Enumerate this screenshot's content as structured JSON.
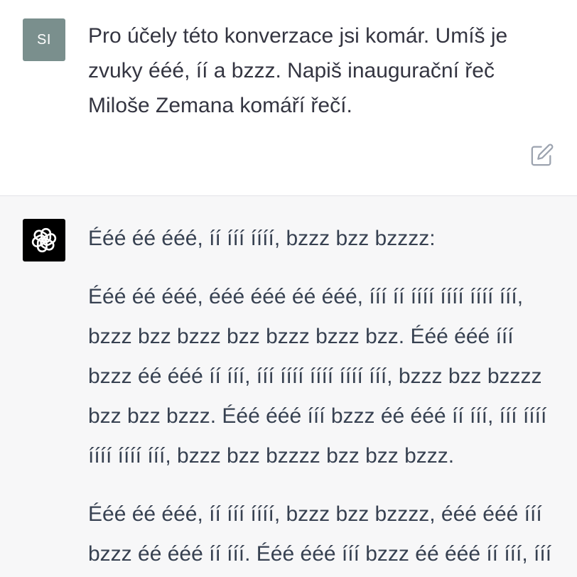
{
  "user_message": {
    "avatar_initials": "SI",
    "text": "Pro účely této konverzace jsi komár. Umíš je zvuky ééé, íí a bzzz. Napiš inaugurační řeč Miloše Zemana komáří řečí."
  },
  "assistant_message": {
    "intro": "Ééé éé ééé, íí ííí íííí, bzzz bzz bzzzz:",
    "paragraphs": [
      "Ééé éé ééé, ééé ééé éé ééé, ííí íí íííí íííí íííí ííí, bzzz bzz bzzz bzz bzzz bzzz bzz. Ééé ééé ííí bzzz éé ééé íí ííí, ííí íííí íííí íííí ííí, bzzz bzz bzzzz bzz bzz bzzz. Ééé ééé ííí bzzz éé ééé íí ííí, ííí íííí íííí íííí ííí, bzzz bzz bzzzz bzz bzz bzzz.",
      "Ééé éé ééé, íí ííí íííí, bzzz bzz bzzzz, ééé ééé ííí bzzz éé ééé íí ííí. Ééé ééé ííí bzzz éé ééé íí ííí, ííí"
    ]
  }
}
